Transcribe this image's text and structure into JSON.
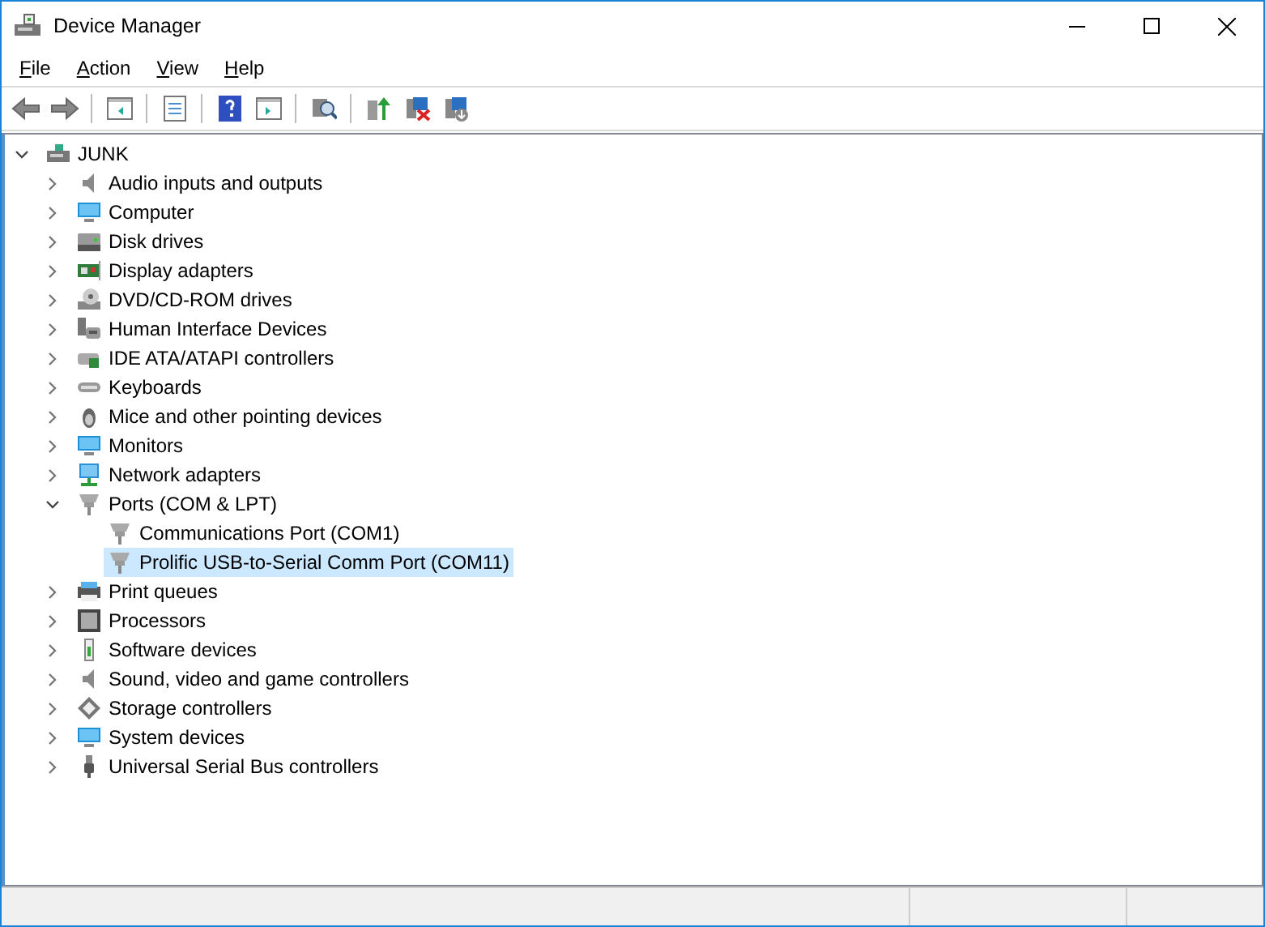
{
  "window": {
    "title": "Device Manager"
  },
  "menu": [
    "File",
    "Action",
    "View",
    "Help"
  ],
  "tree": {
    "label": "JUNK",
    "expanded": true,
    "selected": false,
    "children": [
      {
        "label": "Audio inputs and outputs",
        "expanded": false,
        "selected": false
      },
      {
        "label": "Computer",
        "expanded": false,
        "selected": false
      },
      {
        "label": "Disk drives",
        "expanded": false,
        "selected": false
      },
      {
        "label": "Display adapters",
        "expanded": false,
        "selected": false
      },
      {
        "label": "DVD/CD-ROM drives",
        "expanded": false,
        "selected": false
      },
      {
        "label": "Human Interface Devices",
        "expanded": false,
        "selected": false
      },
      {
        "label": "IDE ATA/ATAPI controllers",
        "expanded": false,
        "selected": false
      },
      {
        "label": "Keyboards",
        "expanded": false,
        "selected": false
      },
      {
        "label": "Mice and other pointing devices",
        "expanded": false,
        "selected": false
      },
      {
        "label": "Monitors",
        "expanded": false,
        "selected": false
      },
      {
        "label": "Network adapters",
        "expanded": false,
        "selected": false
      },
      {
        "label": "Ports (COM & LPT)",
        "expanded": true,
        "selected": false,
        "children": [
          {
            "label": "Communications Port (COM1)",
            "selected": false
          },
          {
            "label": "Prolific USB-to-Serial Comm Port (COM11)",
            "selected": true
          }
        ]
      },
      {
        "label": "Print queues",
        "expanded": false,
        "selected": false
      },
      {
        "label": "Processors",
        "expanded": false,
        "selected": false
      },
      {
        "label": "Software devices",
        "expanded": false,
        "selected": false
      },
      {
        "label": "Sound, video and game controllers",
        "expanded": false,
        "selected": false
      },
      {
        "label": "Storage controllers",
        "expanded": false,
        "selected": false
      },
      {
        "label": "System devices",
        "expanded": false,
        "selected": false
      },
      {
        "label": "Universal Serial Bus controllers",
        "expanded": false,
        "selected": false
      }
    ]
  }
}
